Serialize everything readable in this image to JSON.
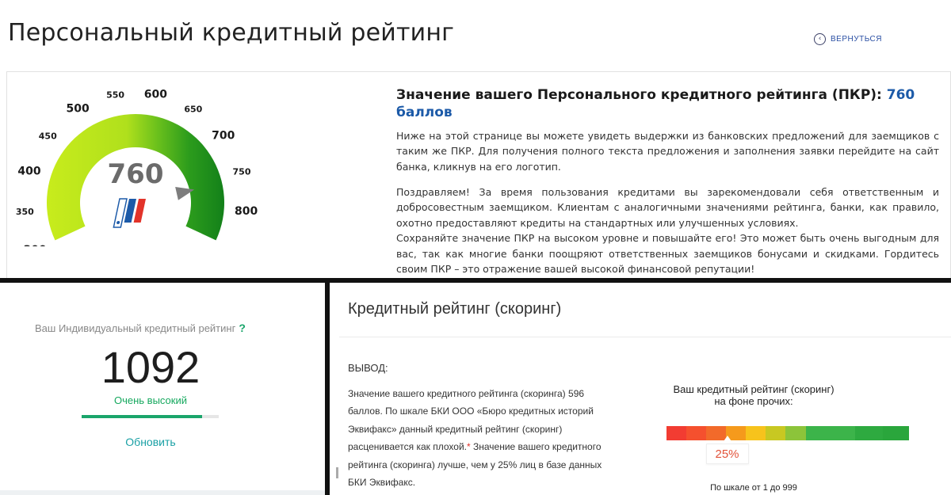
{
  "header": {
    "title": "Персональный кредитный рейтинг",
    "back_label": "ВЕРНУТЬСЯ"
  },
  "pkr": {
    "gauge": {
      "value": "760",
      "min": 300,
      "max": 850,
      "ticks": [
        "300",
        "350",
        "400",
        "450",
        "500",
        "550",
        "600",
        "650",
        "700",
        "750",
        "800",
        "850"
      ],
      "colors": {
        "light": "#c8ec1c",
        "mid": "#6cc11c",
        "dark": "#13801a",
        "needle": "#7d7d7d",
        "number": "#6b6b6b"
      }
    },
    "heading_prefix": "Значение вашего Персонального кредитного рейтинга (ПКР): ",
    "heading_value": "760 баллов",
    "paragraph1": "Ниже на этой странице вы можете увидеть выдержки из банковских предложений для заемщиков с таким же ПКР. Для получения полного текста предложения и заполнения заявки перейдите на сайт банка, кликнув на его логотип.",
    "paragraph2_a": "Поздравляем! За время пользования кредитами вы зарекомендовали себя ответственным и добросовестным заемщиком. Клиентам с аналогичными значениями рейтинга, банки, как правило, охотно предоставляют кредиты на стандартных или улучшенных условиях.",
    "paragraph2_b": "Сохраняйте значение ПКР на высоком уровне и повышайте его! Это может быть очень выгодным для вас, так как многие банки поощряют ответственных заемщиков бонусами и скидками. Гордитесь своим ПКР – это отражение вашей высокой финансовой репутации!"
  },
  "ikr": {
    "label": "Ваш Индивидуальный кредитный рейтинг",
    "help": "?",
    "value": "1092",
    "level": "Очень высокий",
    "progress": 0.88,
    "refresh": "Обновить"
  },
  "scoring": {
    "title": "Кредитный рейтинг (скоринг)",
    "conclusion_label": "ВЫВОД:",
    "text_a": "Значение вашего кредитного рейтинга (скоринга) 596 баллов. По шкале БКИ ООО «Бюро кредитных историй Эквифакс» данный кредитный рейтинг (скоринг) расценивается как плохой.",
    "star": "*",
    "text_b": " Значение вашего кредитного рейтинга (скоринга) лучше, чем у 25% лиц в базе данных БКИ Эквифакс.",
    "scale_title": "Ваш кредитный рейтинг (скоринг) на фоне прочих:",
    "scale_colors": [
      "#f23c32",
      "#f5502e",
      "#f26a2a",
      "#f59a1c",
      "#f7c31c",
      "#c8c822",
      "#8cc43a",
      "#3cb44a",
      "#2eaa40",
      "#2aa63c"
    ],
    "scale_weights": [
      1,
      1,
      1,
      1,
      1,
      1,
      1,
      2.5,
      1.4,
      1.3
    ],
    "percentile": "25%",
    "percentile_fraction": 0.25,
    "scale_caption": "По шкале от 1 до 999"
  }
}
